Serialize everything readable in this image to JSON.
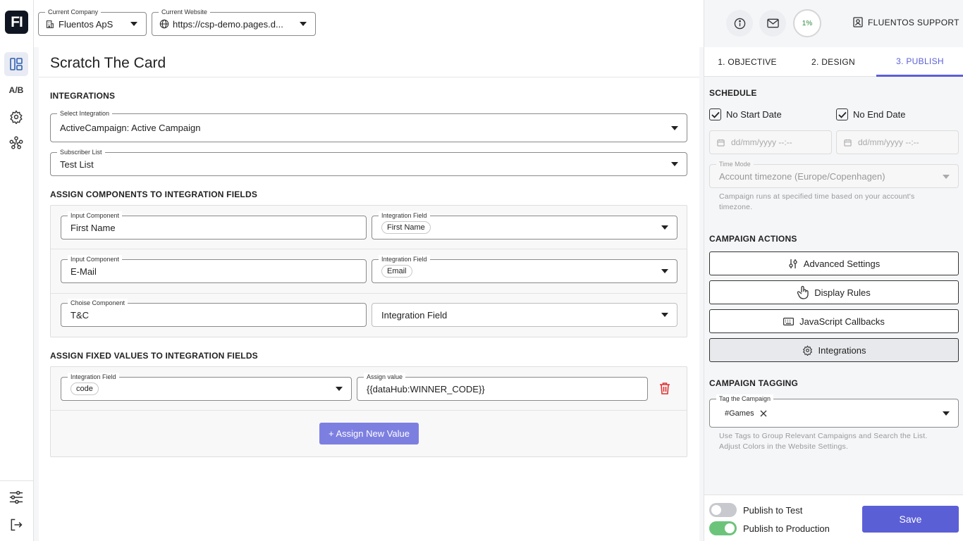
{
  "app": {
    "logo": "FI"
  },
  "rail": {
    "ab_label": "A/B"
  },
  "header": {
    "company": {
      "label": "Current Company",
      "value": "Fluentos ApS"
    },
    "website": {
      "label": "Current Website",
      "value": "https://csp-demo.pages.d..."
    }
  },
  "main": {
    "title": "Scratch The Card",
    "integrations": {
      "heading": "INTEGRATIONS",
      "select": {
        "label": "Select Integration",
        "value": "ActiveCampaign: Active Campaign"
      },
      "list": {
        "label": "Subscriber List",
        "value": "Test List"
      }
    },
    "assign_components": {
      "heading": "ASSIGN COMPONENTS TO INTEGRATION FIELDS",
      "rows": [
        {
          "comp_label": "Input Component",
          "comp_value": "First Name",
          "field_label": "Integration Field",
          "field_value": "First Name"
        },
        {
          "comp_label": "Input Component",
          "comp_value": "E-Mail",
          "field_label": "Integration Field",
          "field_value": "Email"
        },
        {
          "comp_label": "Choise Component",
          "comp_value": "T&C",
          "field_placeholder": "Integration Field"
        }
      ]
    },
    "assign_fixed": {
      "heading": "ASSIGN FIXED VALUES TO INTEGRATION FIELDS",
      "row": {
        "field_label": "Integration Field",
        "field_value": "code",
        "value_label": "Assign value",
        "value": "{{dataHub:WINNER_CODE}}"
      },
      "add_button": "+ Assign New Value"
    }
  },
  "right": {
    "progress": "1%",
    "support": "FLUENTOS SUPPORT",
    "tabs": [
      "1. OBJECTIVE",
      "2. DESIGN",
      "3. PUBLISH"
    ],
    "schedule": {
      "heading": "SCHEDULE",
      "no_start": "No Start Date",
      "no_end": "No End Date",
      "start_placeholder": "dd/mm/yyyy --:--",
      "end_placeholder": "dd/mm/yyyy --:--",
      "time_mode_label": "Time Mode",
      "time_mode_value": "Account timezone (Europe/Copenhagen)",
      "help_1": "Campaign runs at specified time based on your account's",
      "help_2": "timezone."
    },
    "actions": {
      "heading": "CAMPAIGN ACTIONS",
      "advanced": "Advanced Settings",
      "display": "Display Rules",
      "js": "JavaScript Callbacks",
      "integrations": "Integrations"
    },
    "tagging": {
      "heading": "CAMPAIGN TAGGING",
      "label": "Tag the Campaign",
      "tag": "#Games",
      "help_1": "Use Tags to Group Relevant Campaigns and Search the List.",
      "help_2": "Adjust Colors in the Website Settings."
    },
    "publish": {
      "test": "Publish to Test",
      "production": "Publish to Production",
      "save": "Save"
    }
  },
  "colors": {
    "accent": "#5b5fd6",
    "button": "#7d7fe0",
    "toggle_on": "#6cc47a",
    "danger": "#e03131"
  }
}
